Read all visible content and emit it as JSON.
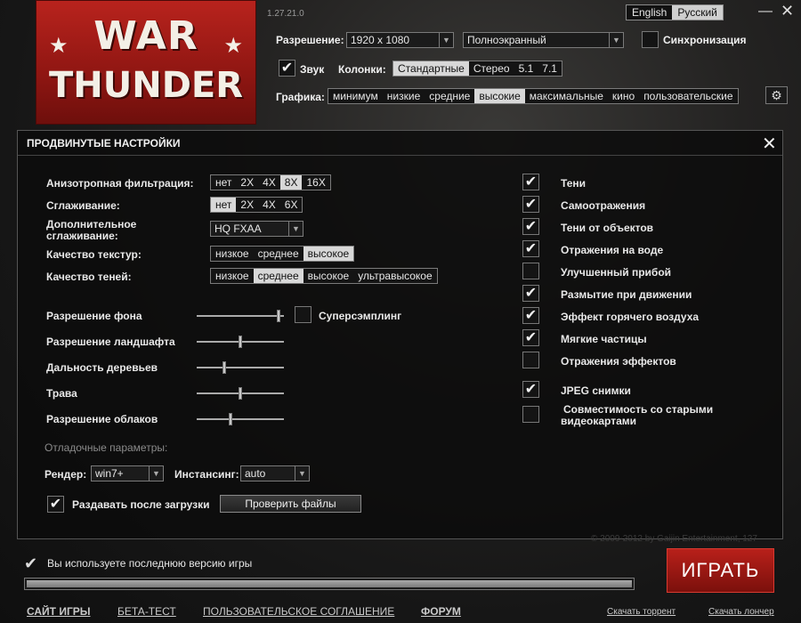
{
  "app": {
    "version": "1.27.21.0"
  },
  "logo": {
    "line1": "WAR",
    "line2": "THUNDER",
    "star": "★"
  },
  "lang": {
    "en": "English",
    "ru": "Русский"
  },
  "window": {
    "minimize": "—",
    "close": "✕"
  },
  "settings": {
    "resolution_label": "Разрешение:",
    "resolution_value": "1920 x 1080",
    "mode_value": "Полноэкранный",
    "sync_label": "Синхронизация",
    "sync_checked": false,
    "sound_label": "Звук",
    "sound_checked": true,
    "speakers_label": "Колонки:",
    "speakers_options": [
      "Стандартные",
      "Стерео",
      "5.1",
      "7.1"
    ],
    "speakers_selected": 0,
    "graphics_label": "Графика:",
    "graphics_options": [
      "минимум",
      "низкие",
      "средние",
      "высокие",
      "максимальные",
      "кино",
      "пользовательские"
    ],
    "graphics_selected": 3
  },
  "panel": {
    "title": "ПРОДВИНУТЫЕ НАСТРОЙКИ",
    "close": "✕",
    "aniso_label": "Анизотропная фильтрация:",
    "aniso_options": [
      "нет",
      "2X",
      "4X",
      "8X",
      "16X"
    ],
    "aniso_selected": 3,
    "aa_label": "Сглаживание:",
    "aa_options": [
      "нет",
      "2X",
      "4X",
      "6X"
    ],
    "aa_selected": 0,
    "extra_aa_label_1": "Дополнительное",
    "extra_aa_label_2": "сглаживание:",
    "extra_aa_value": "HQ FXAA",
    "texture_label": "Качество текстур:",
    "texture_options": [
      "низкое",
      "среднее",
      "высокое"
    ],
    "texture_selected": 2,
    "shadow_label": "Качество теней:",
    "shadow_options": [
      "низкое",
      "среднее",
      "высокое",
      "ультравысокое"
    ],
    "shadow_selected": 1,
    "sliders": [
      {
        "label": "Разрешение фона",
        "value": 0.96
      },
      {
        "label": "Разрешение ландшафта",
        "value": 0.5
      },
      {
        "label": "Дальность деревьев",
        "value": 0.31
      },
      {
        "label": "Трава",
        "value": 0.5
      },
      {
        "label": "Разрешение облаков",
        "value": 0.38
      }
    ],
    "supersampling_label": "Суперсэмплинг",
    "supersampling_checked": false,
    "debug_label": "Отладочные параметры:",
    "render_label": "Рендер:",
    "render_value": "win7+",
    "instancing_label": "Инстансинг:",
    "instancing_value": "auto",
    "seed_label": "Раздавать после загрузки",
    "seed_checked": true,
    "verify_button": "Проверить файлы",
    "checkboxes": [
      {
        "label": "Тени",
        "checked": true
      },
      {
        "label": "Самоотражения",
        "checked": true
      },
      {
        "label": "Тени от объектов",
        "checked": true
      },
      {
        "label": "Отражения на воде",
        "checked": true
      },
      {
        "label": "Улучшенный прибой",
        "checked": false
      },
      {
        "label": "Размытие при движении",
        "checked": true
      },
      {
        "label": "Эффект горячего воздуха",
        "checked": true
      },
      {
        "label": "Мягкие частицы",
        "checked": true
      },
      {
        "label": "Отражения эффектов",
        "checked": false
      },
      {
        "label": "JPEG снимки",
        "checked": true
      }
    ],
    "compat_label_1": "Совместимость со старыми",
    "compat_label_2": "видеокартами",
    "compat_checked": false
  },
  "status": {
    "text": "Вы используете последнюю версию игры",
    "check": "✔",
    "progress": 1.0
  },
  "play_button": "ИГРАТЬ",
  "copyright": "© 2009-2012 by Gaijin Entertainment, 127",
  "footer": {
    "site": "САЙТ ИГРЫ",
    "beta": "БЕТА-ТЕСТ",
    "agreement": "ПОЛЬЗОВАТЕЛЬСКОЕ СОГЛАШЕНИЕ",
    "forum": "ФОРУМ",
    "torrent": "Скачать торрент",
    "launcher": "Скачать лончер"
  },
  "icons": {
    "check": "✔",
    "gear": "⚙",
    "chevron": "▼"
  }
}
